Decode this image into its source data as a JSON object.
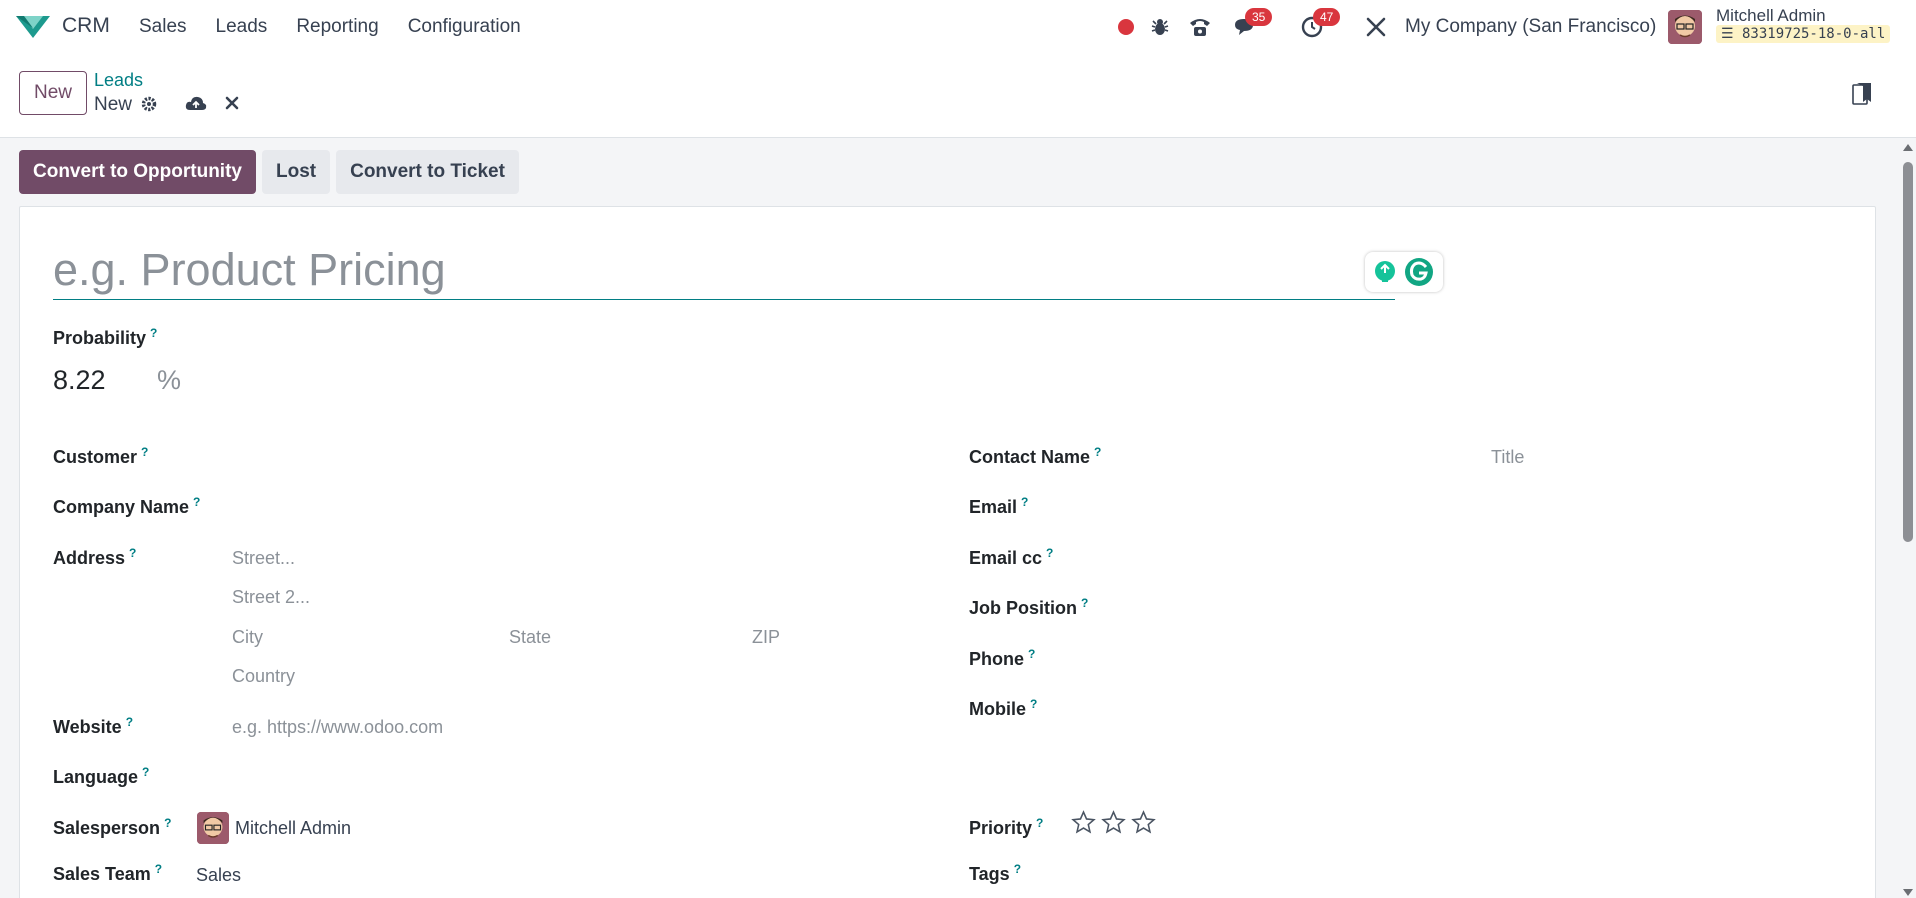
{
  "app": {
    "name": "CRM",
    "menu": [
      "Sales",
      "Leads",
      "Reporting",
      "Configuration"
    ]
  },
  "systray": {
    "messages_count": "35",
    "activities_count": "47",
    "company": "My Company (San Francisco)",
    "user_name": "Mitchell Admin",
    "database": "83319725-18-0-all"
  },
  "control_panel": {
    "new_label": "New",
    "breadcrumb_parent": "Leads",
    "breadcrumb_current": "New"
  },
  "statusbar": {
    "convert_opportunity": "Convert to Opportunity",
    "lost": "Lost",
    "convert_ticket": "Convert to Ticket"
  },
  "form": {
    "title_placeholder": "e.g. Product Pricing",
    "probability_label": "Probability",
    "probability_value": "8.22",
    "probability_unit": "%",
    "customer_label": "Customer",
    "company_name_label": "Company Name",
    "address_label": "Address",
    "street_placeholder": "Street...",
    "street2_placeholder": "Street 2...",
    "city_placeholder": "City",
    "state_placeholder": "State",
    "zip_placeholder": "ZIP",
    "country_placeholder": "Country",
    "website_label": "Website",
    "website_placeholder": "e.g. https://www.odoo.com",
    "language_label": "Language",
    "salesperson_label": "Salesperson",
    "salesperson_value": "Mitchell Admin",
    "sales_team_label": "Sales Team",
    "sales_team_value": "Sales",
    "contact_name_label": "Contact Name",
    "title_field_placeholder": "Title",
    "email_label": "Email",
    "email_cc_label": "Email cc",
    "job_position_label": "Job Position",
    "phone_label": "Phone",
    "mobile_label": "Mobile",
    "priority_label": "Priority",
    "tags_label": "Tags",
    "help_mark": "?"
  },
  "colors": {
    "brand": "#714b67",
    "link": "#017e84",
    "badge": "#d9363e"
  }
}
